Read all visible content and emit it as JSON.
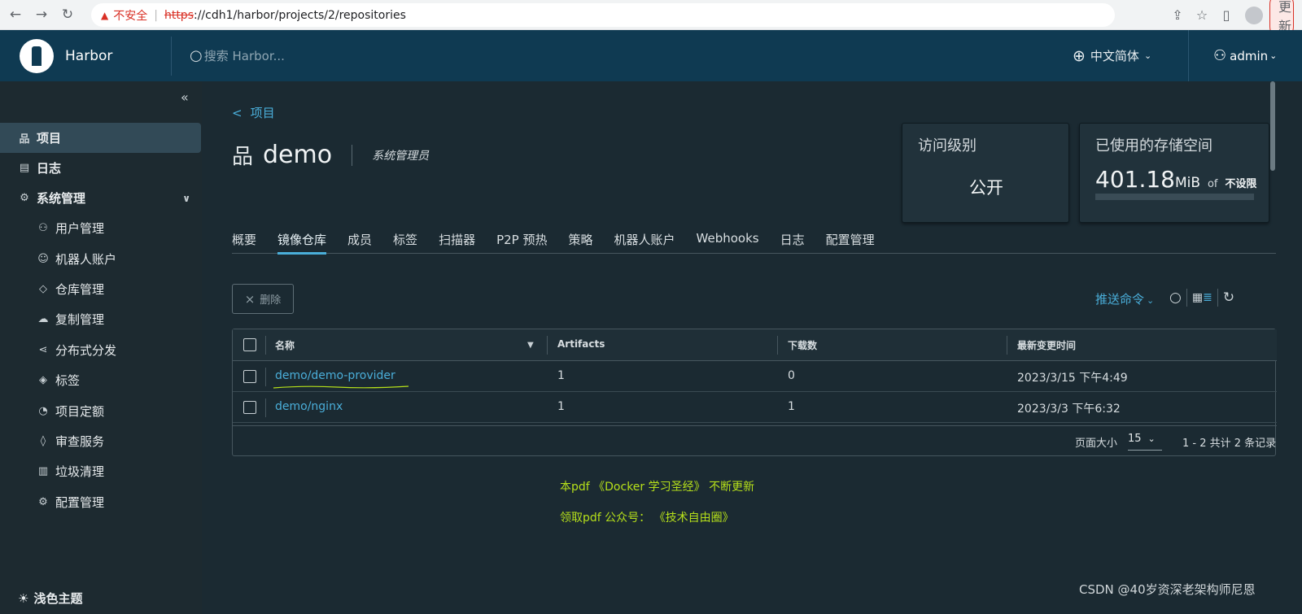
{
  "browser": {
    "insecure_label": "不安全",
    "url_scheme": "https",
    "url_rest": "://cdh1/harbor/projects/2/repositories",
    "update_label": "更新"
  },
  "header": {
    "brand": "Harbor",
    "search_placeholder": "搜索 Harbor...",
    "language": "中文简体",
    "user": "admin"
  },
  "sidebar": {
    "items": [
      {
        "label": "项目",
        "icon": "projects-icon"
      },
      {
        "label": "日志",
        "icon": "logs-icon"
      },
      {
        "label": "系统管理",
        "icon": "admin-icon"
      },
      {
        "label": "用户管理",
        "icon": "users-icon"
      },
      {
        "label": "机器人账户",
        "icon": "robot-icon"
      },
      {
        "label": "仓库管理",
        "icon": "registry-icon"
      },
      {
        "label": "复制管理",
        "icon": "replication-icon"
      },
      {
        "label": "分布式分发",
        "icon": "distribution-icon"
      },
      {
        "label": "标签",
        "icon": "tag-icon"
      },
      {
        "label": "项目定额",
        "icon": "quota-icon"
      },
      {
        "label": "审查服务",
        "icon": "shield-icon"
      },
      {
        "label": "垃圾清理",
        "icon": "trash-icon"
      },
      {
        "label": "配置管理",
        "icon": "gear-icon"
      }
    ],
    "theme_label": "浅色主题"
  },
  "project": {
    "back_label": "项目",
    "name": "demo",
    "role": "系统管理员",
    "access_title": "访问级别",
    "access_value": "公开",
    "storage_title": "已使用的存储空间",
    "storage_value": "401.18",
    "storage_unit": "MiB",
    "storage_of": "of",
    "storage_limit": "不设限"
  },
  "tabs": [
    "概要",
    "镜像仓库",
    "成员",
    "标签",
    "扫描器",
    "P2P 预热",
    "策略",
    "机器人账户",
    "Webhooks",
    "日志",
    "配置管理"
  ],
  "toolbar": {
    "delete_label": "删除",
    "push_label": "推送命令"
  },
  "table": {
    "columns": [
      "名称",
      "Artifacts",
      "下载数",
      "最新变更时间"
    ],
    "rows": [
      {
        "name": "demo/demo-provider",
        "artifacts": "1",
        "downloads": "0",
        "updated": "2023/3/15 下午4:49"
      },
      {
        "name": "demo/nginx",
        "artifacts": "1",
        "downloads": "1",
        "updated": "2023/3/3 下午6:32"
      }
    ],
    "page_size_label": "页面大小",
    "page_size": "15",
    "summary": "1 - 2 共计 2 条记录"
  },
  "notes": {
    "line1": "本pdf 《Docker 学习圣经》 不断更新",
    "line2": "领取pdf 公众号：  《技术自由圈》"
  },
  "watermark": "CSDN @40岁资深老架构师尼恩",
  "colors": {
    "accent": "#4aaed9",
    "header": "#0f3a52",
    "note": "#b6e01a"
  }
}
